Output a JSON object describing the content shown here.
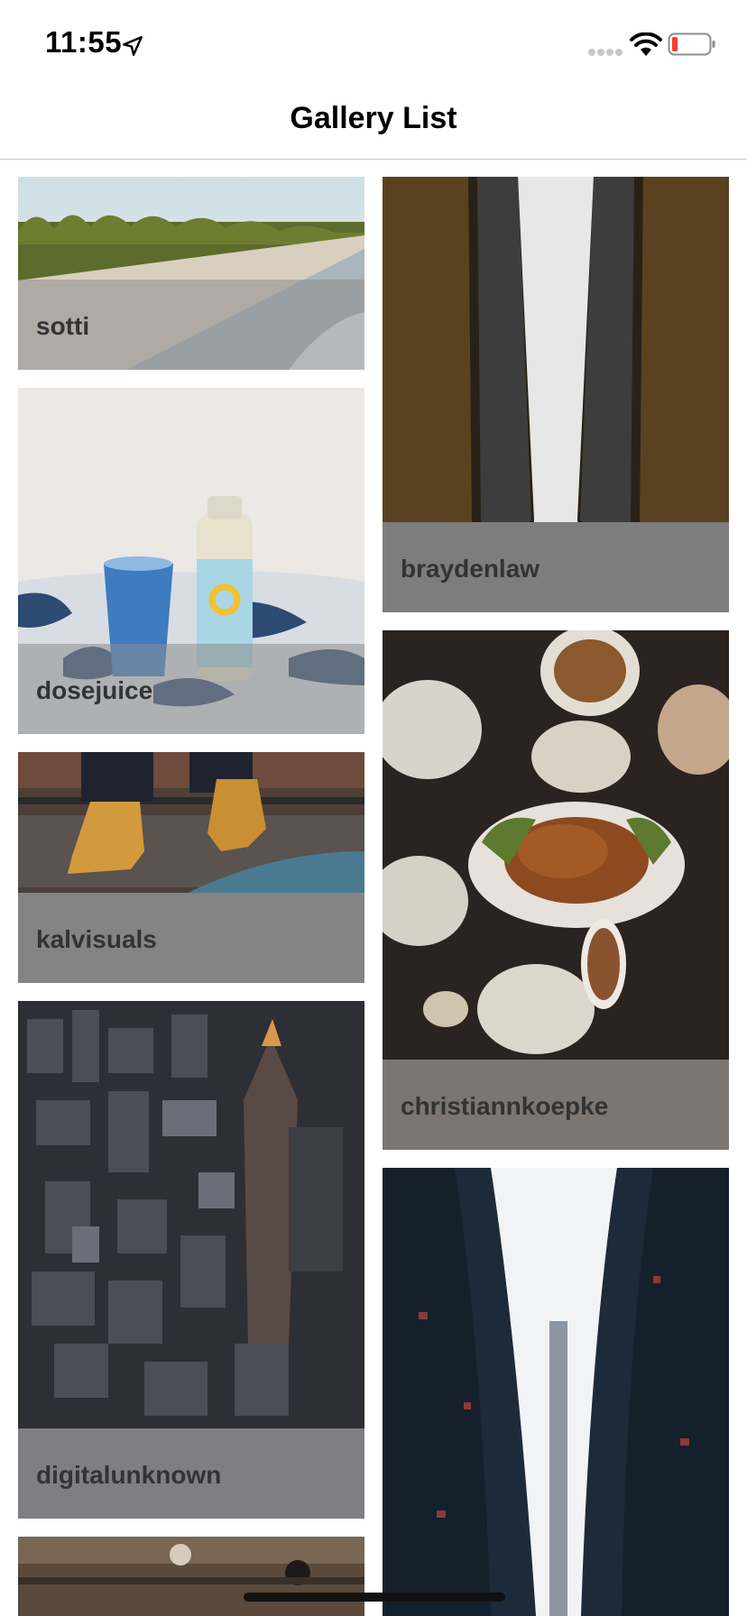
{
  "status_bar": {
    "time": "11:55"
  },
  "nav": {
    "title": "Gallery List"
  },
  "gallery": {
    "items": [
      {
        "caption": "sotti",
        "scene": "tropical-beach"
      },
      {
        "caption": "braydenlaw",
        "scene": "skyscraper-corridor"
      },
      {
        "caption": "dosejuice",
        "scene": "juice-bottle-and-glass"
      },
      {
        "caption": "christiannkoepke",
        "scene": "roast-turkey-dinner"
      },
      {
        "caption": "kalvisuals",
        "scene": "boots-on-railway"
      },
      {
        "caption": "digitalunknown",
        "scene": "aerial-city"
      },
      {
        "caption": "",
        "scene": "dense-apartment-towers"
      },
      {
        "caption": "",
        "scene": "interior-ceiling"
      }
    ]
  }
}
